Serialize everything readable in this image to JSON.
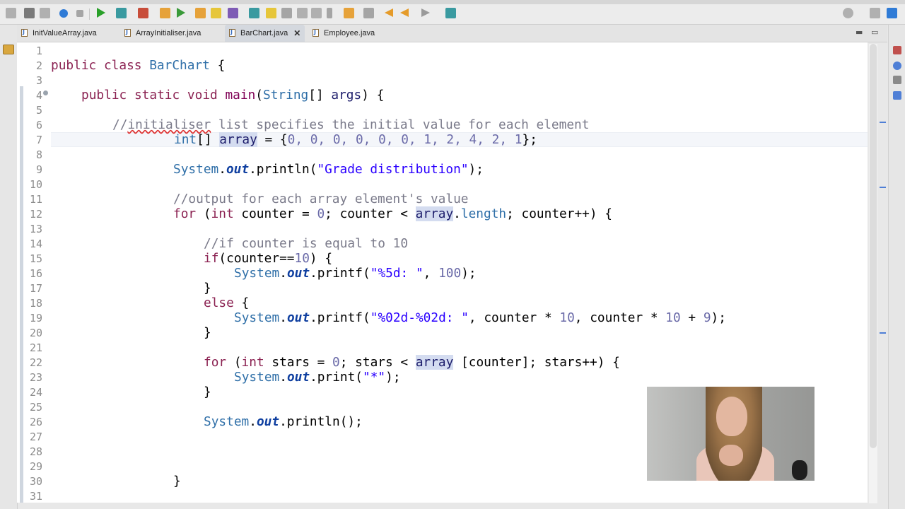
{
  "tabs": [
    {
      "label": "InitValueArray.java",
      "active": false
    },
    {
      "label": "ArrayInitialiser.java",
      "active": false
    },
    {
      "label": "BarChart.java",
      "active": true
    },
    {
      "label": "Employee.java",
      "active": false
    }
  ],
  "tab_close": "✕",
  "window_controls": {
    "minimize": "▬",
    "maximize": "▭"
  },
  "line_numbers": [
    "1",
    "2",
    "3",
    "4",
    "5",
    "6",
    "7",
    "8",
    "9",
    "10",
    "11",
    "12",
    "13",
    "14",
    "15",
    "16",
    "17",
    "18",
    "19",
    "20",
    "21",
    "22",
    "23",
    "24",
    "25",
    "26",
    "27",
    "28",
    "29",
    "30",
    "31"
  ],
  "code": {
    "l2_kw1": "public",
    "l2_kw2": "class",
    "l2_name": "BarChart",
    "l2_brace": " {",
    "l4_kw1": "public",
    "l4_kw2": "static",
    "l4_kw3": "void",
    "l4_name": "main",
    "l4_open": "(",
    "l4_type": "String",
    "l4_arr": "[] ",
    "l4_arg": "args",
    "l4_close": ") {",
    "l6_cmt_a": "//",
    "l6_cmt_b": "initialiser",
    "l6_cmt_c": " list specifies the initial value for each element",
    "l7_type": "int",
    "l7_brk": "[] ",
    "l7_var": "array",
    "l7_eq": " = {",
    "l7_vals": "0, 0, 0, 0, 0, 0, 1, 2, 4, 2, 1",
    "l7_end": "};",
    "l9_cls": "System",
    "l9_dot1": ".",
    "l9_out": "out",
    "l9_call": ".println(",
    "l9_str": "\"Grade distribution\"",
    "l9_end": ");",
    "l11_cmt": "//output for each array element's value",
    "l12_for": "for",
    "l12_a": " (",
    "l12_int": "int",
    "l12_b": " counter = ",
    "l12_zero": "0",
    "l12_c": "; counter < ",
    "l12_arr": "array",
    "l12_d": ".",
    "l12_len": "length",
    "l12_e": "; counter++) {",
    "l14_cmt": "//if counter is equal to 10",
    "l15_if": "if",
    "l15_a": "(counter==",
    "l15_num": "10",
    "l15_b": ") {",
    "l16_cls": "System",
    "l16_dot": ".",
    "l16_out": "out",
    "l16_call": ".printf(",
    "l16_str": "\"%5d: \"",
    "l16_comma": ", ",
    "l16_num": "100",
    "l16_end": ");",
    "l17": "}",
    "l18_else": "else",
    "l18_brace": " {",
    "l19_cls": "System",
    "l19_dot": ".",
    "l19_out": "out",
    "l19_call": ".printf(",
    "l19_str": "\"%02d-%02d: \"",
    "l19_a": ", counter * ",
    "l19_n1": "10",
    "l19_b": ", counter * ",
    "l19_n2": "10",
    "l19_c": " + ",
    "l19_n3": "9",
    "l19_end": ");",
    "l20": "}",
    "l22_for": "for",
    "l22_a": " (",
    "l22_int": "int",
    "l22_b": " stars = ",
    "l22_zero": "0",
    "l22_c": "; stars < ",
    "l22_arr": "array",
    "l22_d": " [counter]; stars++) {",
    "l23_cls": "System",
    "l23_dot": ".",
    "l23_out": "out",
    "l23_call": ".print(",
    "l23_str": "\"*\"",
    "l23_end": ");",
    "l24": "}",
    "l26_cls": "System",
    "l26_dot": ".",
    "l26_out": "out",
    "l26_call": ".println();",
    "l30": "}"
  },
  "colors": {
    "keyword": "#8b2252",
    "type": "#2f6fa8",
    "string": "#2a00ff",
    "comment": "#7a7a8a",
    "number": "#6a6aa8",
    "selection_highlight": "#d4dcf0"
  }
}
